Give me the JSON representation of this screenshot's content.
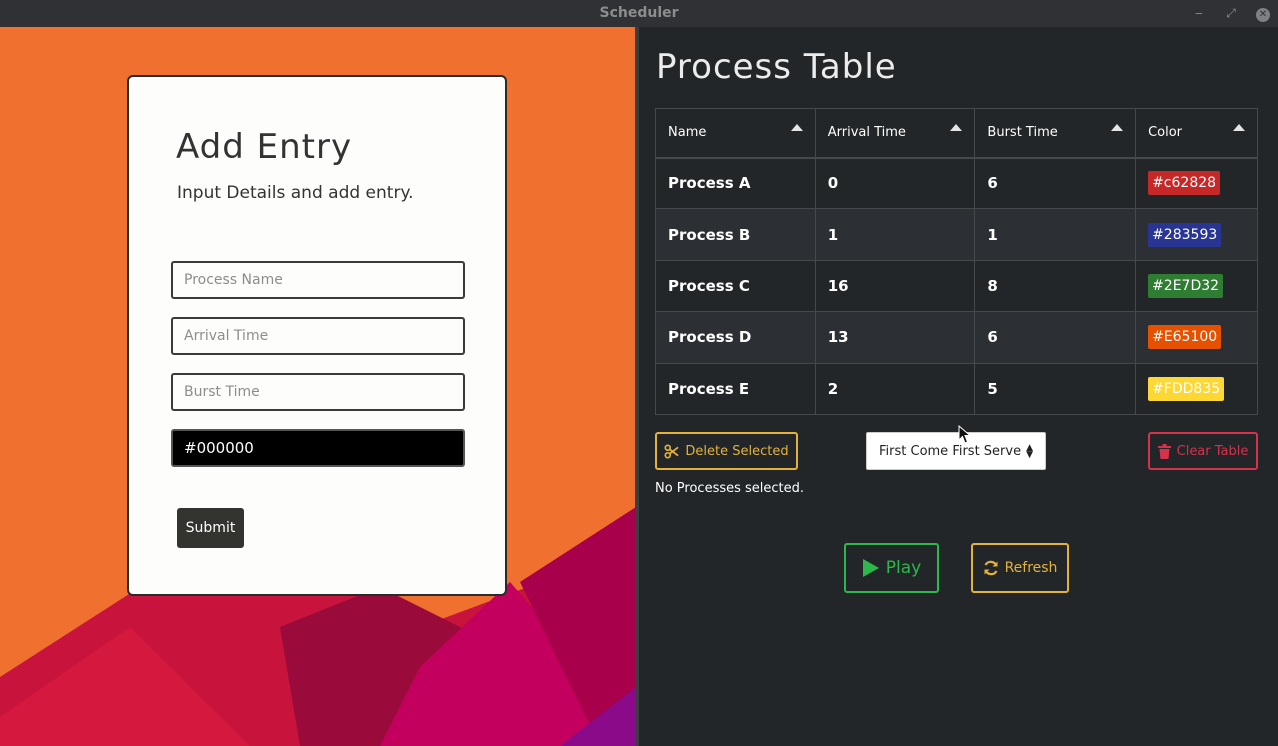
{
  "window": {
    "title": "Scheduler",
    "min_glyph": "‒",
    "max_glyph": "⤢",
    "close_glyph": "✕"
  },
  "form": {
    "title": "Add Entry",
    "subtitle": "Input Details and add entry.",
    "process_name_placeholder": "Process Name",
    "arrival_time_placeholder": "Arrival Time",
    "burst_time_placeholder": "Burst Time",
    "color_value": "#000000",
    "submit_label": "Submit"
  },
  "panel": {
    "title": "Process Table",
    "columns": [
      "Name",
      "Arrival Time",
      "Burst Time",
      "Color"
    ],
    "rows": [
      {
        "name": "Process A",
        "arrival": "0",
        "burst": "6",
        "color": "#c62828",
        "color_label": "#c62828"
      },
      {
        "name": "Process B",
        "arrival": "1",
        "burst": "1",
        "color": "#283593",
        "color_label": "#283593"
      },
      {
        "name": "Process C",
        "arrival": "16",
        "burst": "8",
        "color": "#2E7D32",
        "color_label": "#2E7D32"
      },
      {
        "name": "Process D",
        "arrival": "13",
        "burst": "6",
        "color": "#E65100",
        "color_label": "#E65100"
      },
      {
        "name": "Process E",
        "arrival": "2",
        "burst": "5",
        "color": "#FDD835",
        "color_label": "#FDD835"
      }
    ],
    "delete_label": "Delete Selected",
    "algorithm_selected": "First Come First Serve",
    "clear_label": "Clear Table",
    "selection_status": "No Processes selected.",
    "play_label": "Play",
    "refresh_label": "Refresh"
  },
  "icons": {
    "delete": "scissors-icon",
    "clear": "trash-icon",
    "play": "play-icon",
    "refresh": "refresh-icon"
  },
  "colors": {
    "accent_yellow": "#e3b23c",
    "accent_red": "#d6324c",
    "accent_green": "#2eb74a",
    "wallpaper_orange": "#f07030"
  }
}
